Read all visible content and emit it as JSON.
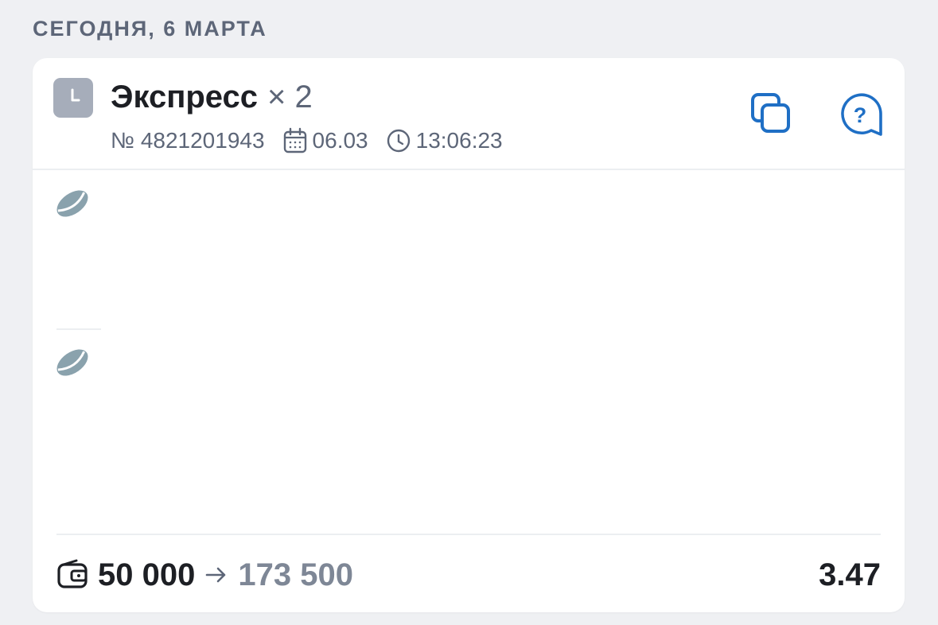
{
  "section_date": "СЕГОДНЯ, 6 МАРТА",
  "bet": {
    "status_icon": "clock-icon",
    "title": "Экспресс",
    "multiplier": "× 2",
    "number": "№ 4821201943",
    "date": "06.03",
    "time": "13:06:23",
    "actions": {
      "copy_icon": "copy-icon",
      "help_icon": "help-chat-icon"
    },
    "events": [
      {
        "sport_icon": "hockey-puck-icon"
      },
      {
        "sport_icon": "hockey-puck-icon"
      }
    ],
    "stake": "50 000",
    "payout": "173 500",
    "odds": "3.47"
  },
  "colors": {
    "background": "#eff0f3",
    "card": "#ffffff",
    "accent_blue": "#1f6fc5",
    "muted_text": "#5d6678",
    "puck": "#8aa2ad"
  }
}
